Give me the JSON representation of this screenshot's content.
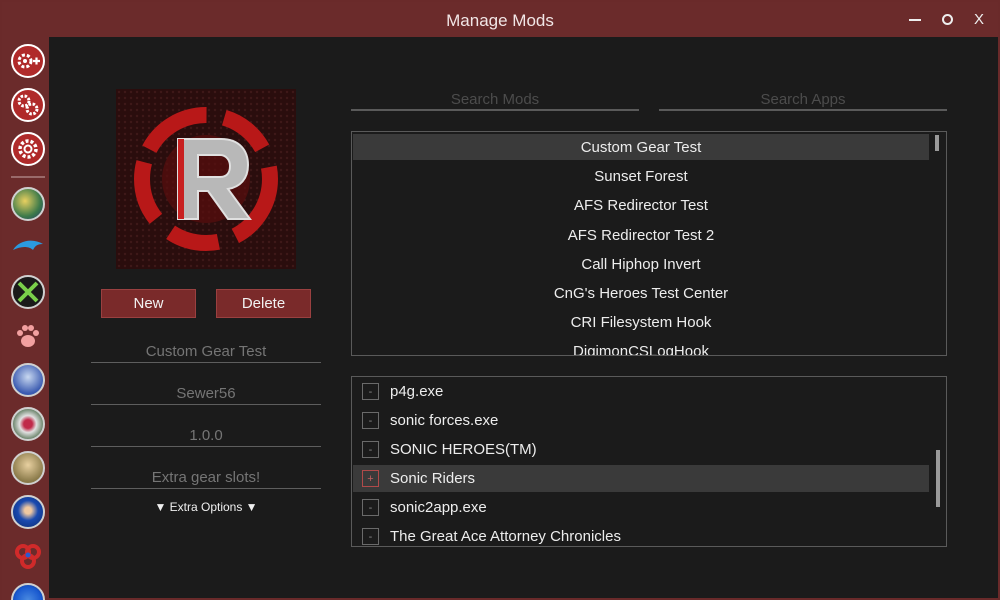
{
  "window": {
    "title": "Manage Mods",
    "controls": {
      "minimize": "—",
      "maximize": "O",
      "close": "X"
    }
  },
  "sidebar": {
    "items": [
      {
        "icon": "add-gear-icon",
        "kind": "gear"
      },
      {
        "icon": "gears-icon",
        "kind": "gear"
      },
      {
        "icon": "settings-gear-icon",
        "kind": "gear"
      },
      {
        "icon": "app-icon-1",
        "kind": "app",
        "color": "#3d7a4a"
      },
      {
        "icon": "dolphin-icon",
        "kind": "app",
        "color": "#2a8fd0"
      },
      {
        "icon": "xenia-icon",
        "kind": "app",
        "color": "#2a2a2a"
      },
      {
        "icon": "paw-icon",
        "kind": "app",
        "color": "#d65a5a"
      },
      {
        "icon": "app-icon-blue",
        "kind": "app",
        "color": "#3a5ab0"
      },
      {
        "icon": "app-icon-heart",
        "kind": "app",
        "color": "#4a6a4a"
      },
      {
        "icon": "app-icon-character",
        "kind": "app",
        "color": "#8a7a4a"
      },
      {
        "icon": "sonic-icon",
        "kind": "app",
        "color": "#1a4ab0"
      },
      {
        "icon": "app-icon-rings",
        "kind": "app",
        "color": "#c02a2a"
      },
      {
        "icon": "app-icon-sonic2",
        "kind": "app",
        "color": "#1a5ad0"
      }
    ]
  },
  "mod_editor": {
    "new_label": "New",
    "delete_label": "Delete",
    "name_placeholder": "Custom Gear Test",
    "author_placeholder": "Sewer56",
    "version_placeholder": "1.0.0",
    "description_placeholder": "Extra gear slots!",
    "extra_options": "▼ Extra Options ▼"
  },
  "search": {
    "mods_placeholder": "Search Mods",
    "apps_placeholder": "Search Apps"
  },
  "mods": [
    "Custom Gear Test",
    "Sunset Forest",
    "AFS Redirector Test",
    "AFS Redirector Test 2",
    "Call Hiphop Invert",
    "CnG's Heroes Test Center",
    "CRI Filesystem Hook",
    "DigimonCSLogHook"
  ],
  "apps": [
    {
      "name": "p4g.exe",
      "checked": false
    },
    {
      "name": "sonic forces.exe",
      "checked": false
    },
    {
      "name": "SONIC HEROES(TM)",
      "checked": false
    },
    {
      "name": "Sonic Riders",
      "checked": true
    },
    {
      "name": "sonic2app.exe",
      "checked": false
    },
    {
      "name": "The Great Ace Attorney Chronicles",
      "checked": false
    }
  ],
  "colors": {
    "accent": "#6b2b2b",
    "button": "#7a2a2a",
    "background": "#1b1b1b",
    "selected_row": "#3a3a3a"
  }
}
